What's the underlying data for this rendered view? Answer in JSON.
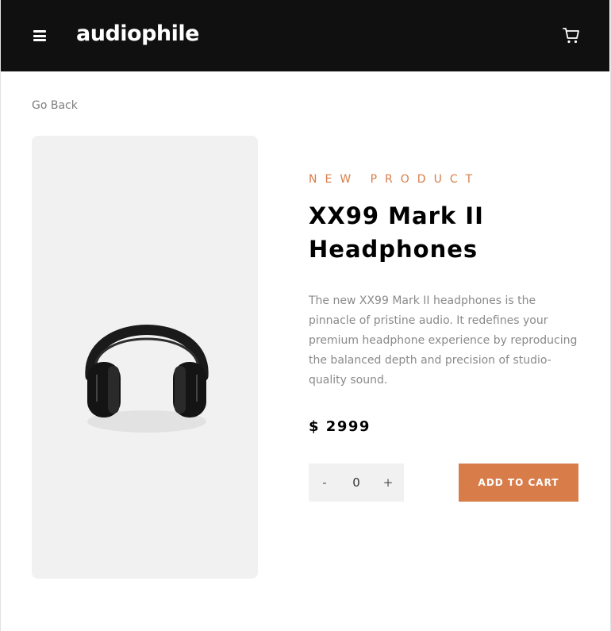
{
  "header": {
    "logo": "audiophile",
    "menu_icon": "hamburger-menu-icon",
    "cart_icon": "cart-icon"
  },
  "nav": {
    "go_back": "Go Back"
  },
  "product": {
    "eyebrow": "NEW PRODUCT",
    "title": "XX99 Mark II Headphones",
    "description": "The new XX99 Mark II headphones is the pinnacle of pristine audio. It redefines your premium headphone experience by reproducing the balanced depth and precision of studio-quality sound.",
    "price": "$ 2999",
    "image_icon": "headphones-image"
  },
  "cart_controls": {
    "minus": "-",
    "quantity": "0",
    "plus": "+",
    "add_to_cart": "ADD TO CART"
  },
  "colors": {
    "accent": "#d87d4a",
    "header_bg": "#101010",
    "image_bg": "#f1f1f1"
  }
}
